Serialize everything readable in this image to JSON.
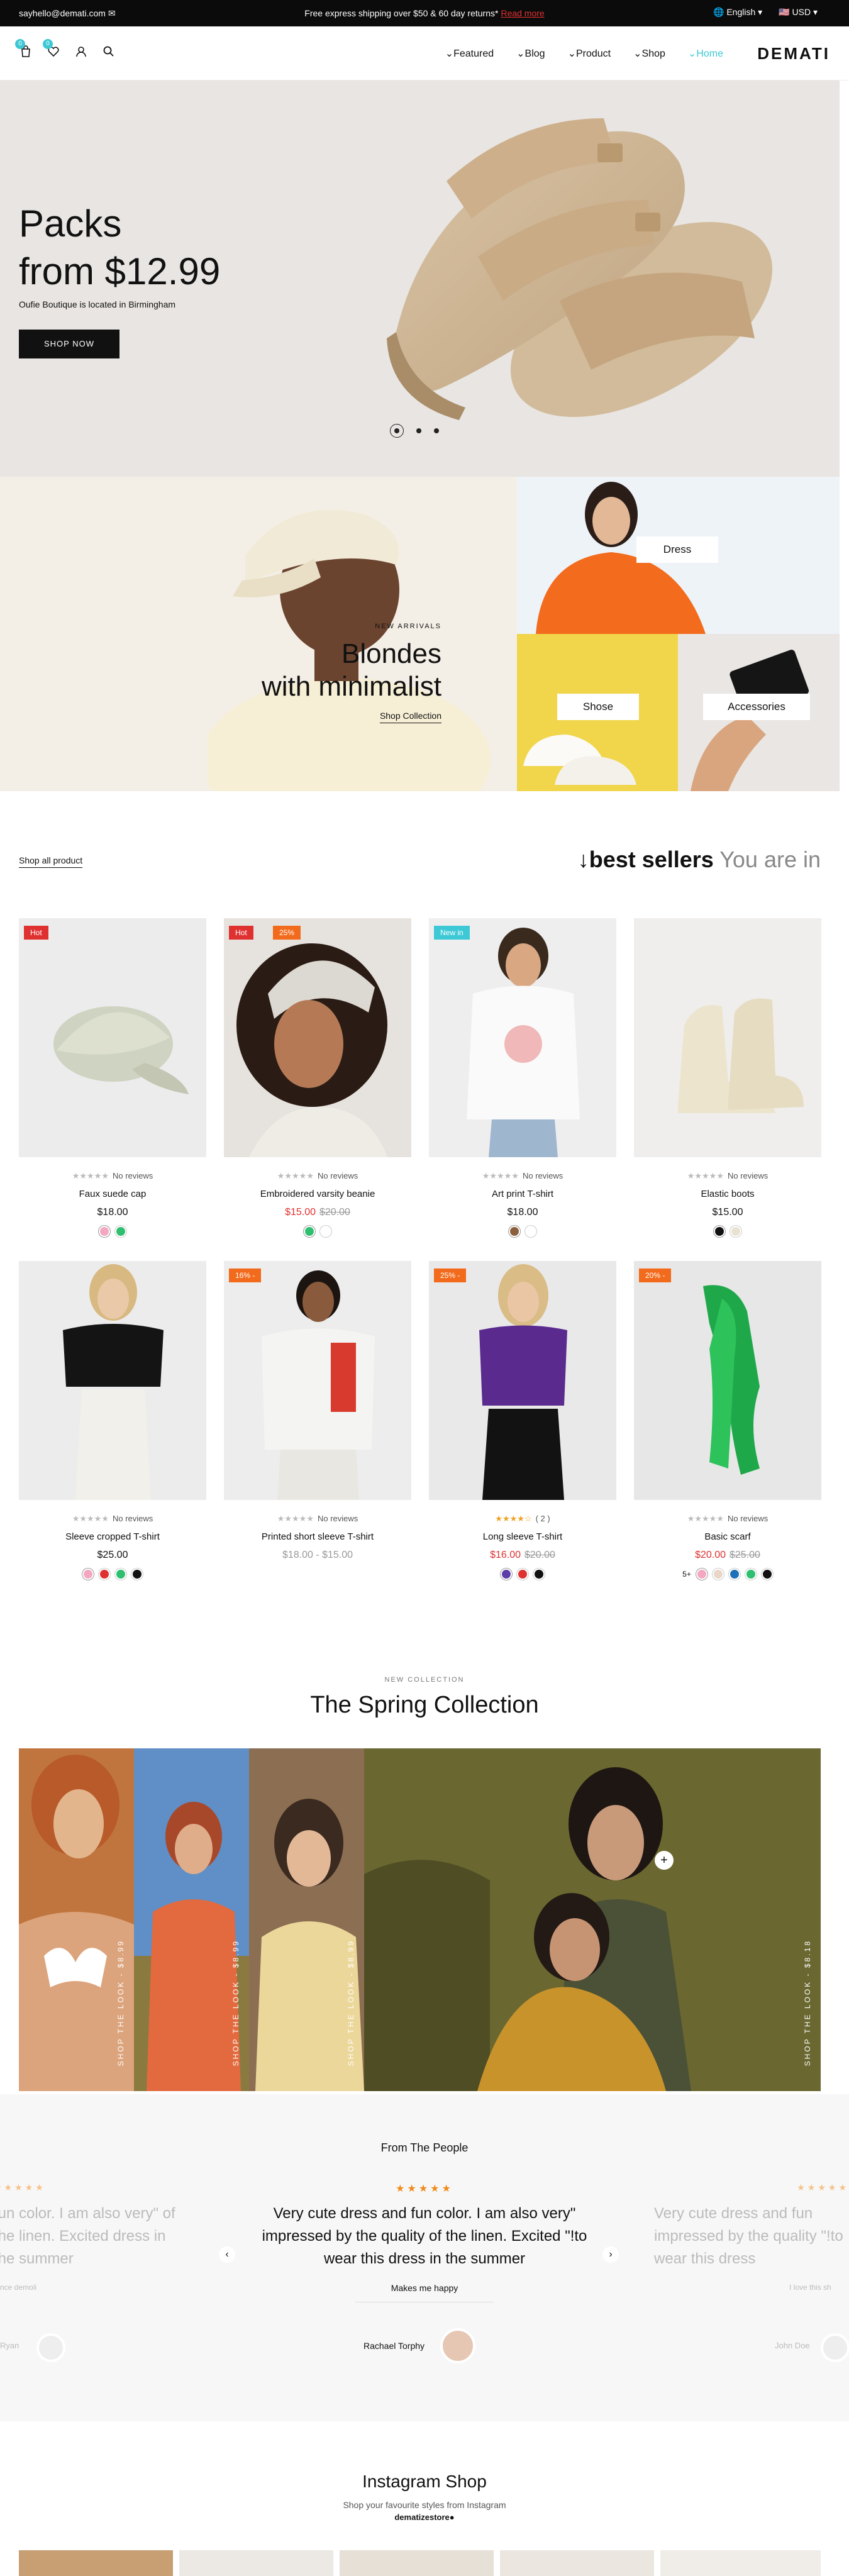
{
  "topbar": {
    "email": "sayhello@demati.com ✉",
    "promo": "Free express shipping over $50 & 60 day returns*",
    "promo_link": "Read more",
    "language": "English",
    "currency": "USD"
  },
  "header": {
    "wishlist_count": "0",
    "cart_count": "0",
    "nav": [
      "Featured",
      "Blog",
      "Product",
      "Shop",
      "Home"
    ],
    "logo": "DEMATI"
  },
  "hero": {
    "title_line1": "Packs",
    "title_line2": "from $12.99",
    "subtitle": "Oufie Boutique is located in Birmingham",
    "button": "SHOP NOW"
  },
  "banner": {
    "eyebrow": "NEW ARRIVALS",
    "title_line1": "Blondes",
    "title_line2": "with minimalist",
    "link": "Shop Collection",
    "tag_dress": "Dress",
    "tag_shoes": "Shose",
    "tag_accessories": "Accessories"
  },
  "bestsellers": {
    "shop_all": "Shop all product",
    "arrow": "↓",
    "heading": "best sellers",
    "heading_suffix": "You are in"
  },
  "products": [
    {
      "name": "Faux suede cap",
      "price": "$18.00",
      "old": "",
      "label": "Hot",
      "label_color": "#e03131",
      "stars": "★★★★★",
      "reviews": "No reviews",
      "swatches": [
        "#f4a7c0",
        "#2fbf71"
      ],
      "bg": "#ececec"
    },
    {
      "name": "Embroidered varsity beanie",
      "price": "$15.00",
      "old": "$20.00",
      "label": "Hot",
      "label2": "25%",
      "label_color": "#e03131",
      "stars": "★★★★★",
      "reviews": "No reviews",
      "swatches": [
        "#2fbf71",
        "#ffffff"
      ],
      "bg": "#e6e3df"
    },
    {
      "name": "Art print T-shirt",
      "price": "$18.00",
      "old": "",
      "label": "New in",
      "label_color": "#3dc8d5",
      "stars": "★★★★★",
      "reviews": "No reviews",
      "swatches": [
        "#8b5e3c",
        "#ffffff"
      ],
      "bg": "#eeeeee"
    },
    {
      "name": "Elastic boots",
      "price": "$15.00",
      "old": "",
      "label": "",
      "label_color": "",
      "stars": "★★★★★",
      "reviews": "No reviews",
      "swatches": [
        "#111111",
        "#e8e2d2"
      ],
      "bg": "#efeeec"
    },
    {
      "name": "Sleeve cropped T-shirt",
      "price": "$25.00",
      "old": "",
      "label": "",
      "label_color": "",
      "stars": "★★★★★",
      "reviews": "No reviews",
      "swatches": [
        "#f4a7c0",
        "#e03131",
        "#2fbf71",
        "#111111"
      ],
      "bg": "#ececec"
    },
    {
      "name": "Printed short sleeve T-shirt",
      "price": "$18.00 - $15.00",
      "old": "",
      "label": "16% -",
      "label_color": "#f26a1b",
      "stars": "★★★★★",
      "reviews": "No reviews",
      "swatches": [],
      "bg": "#ededed"
    },
    {
      "name": "Long sleeve T-shirt",
      "price": "$16.00",
      "old": "$20.00",
      "label": "25% -",
      "label_color": "#f26a1b",
      "stars": "★★★★☆",
      "reviews": "( 2 )",
      "swatches": [
        "#5b3ea8",
        "#e03131",
        "#111111"
      ],
      "bg": "#e9e9e9"
    },
    {
      "name": "Basic scarf",
      "price": "$20.00",
      "old": "$25.00",
      "label": "20% -",
      "label_color": "#f26a1b",
      "stars": "★★★★★",
      "reviews": "No reviews",
      "more": "5+",
      "swatches": [
        "#f4a7c0",
        "#e8d6c8",
        "#1e6fb8",
        "#2fbf71",
        "#111111"
      ],
      "bg": "#e7e7e7"
    }
  ],
  "spring": {
    "eyebrow": "NEW COLLECTION",
    "title": "The Spring Collection",
    "panel_text": "SHOP THE LOOK - $8.99",
    "panel_text_last": "SHOP THE LOOK - $8.18"
  },
  "testimonials": {
    "heading": "From The People",
    "stars": "★★★★★",
    "quote": "Very cute dress and fun color. I am also very\" impressed by the quality of the linen. Excited \"!to wear this dress in the summer",
    "left_quote": "fun color. I am also very\" of the linen. Excited dress in the summer",
    "right_quote": "Very cute dress and fun impressed by the quality \"!to wear this dress",
    "caption": "Makes me happy",
    "left_caption": "nce demoli",
    "right_caption": "I love this sh",
    "author": "Rachael Torphy",
    "left_author": "Ryan",
    "right_author": "John Doe"
  },
  "instagram": {
    "title": "Instagram Shop",
    "subtitle": "Shop your favourite styles from Instagram",
    "handle": "dematizestore●"
  },
  "colors": {
    "accent": "#3dc8d5",
    "sale": "#e03131",
    "label_orange": "#f26a1b"
  }
}
